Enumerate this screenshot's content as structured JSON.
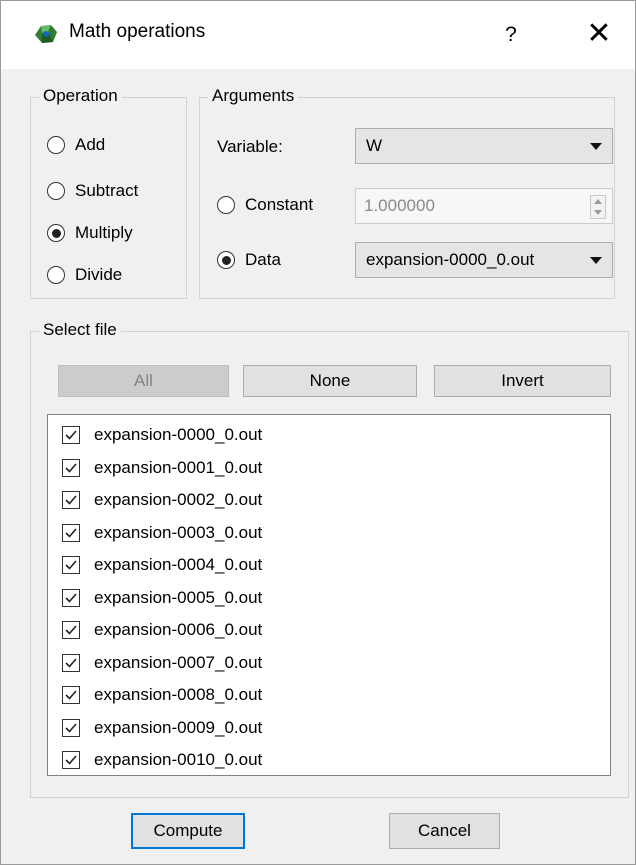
{
  "window": {
    "title": "Math operations",
    "help": "?",
    "close": "✕"
  },
  "operation": {
    "title": "Operation",
    "options": [
      {
        "label": "Add",
        "checked": false
      },
      {
        "label": "Subtract",
        "checked": false
      },
      {
        "label": "Multiply",
        "checked": true
      },
      {
        "label": "Divide",
        "checked": false
      }
    ]
  },
  "arguments": {
    "title": "Arguments",
    "variable_label": "Variable:",
    "variable_value": "W",
    "constant_label": "Constant",
    "constant_value": "1.000000",
    "constant_checked": false,
    "data_label": "Data",
    "data_value": "expansion-0000_0.out",
    "data_checked": true
  },
  "select_file": {
    "title": "Select file",
    "all_label": "All",
    "none_label": "None",
    "invert_label": "Invert",
    "files": [
      {
        "name": "expansion-0000_0.out",
        "checked": true
      },
      {
        "name": "expansion-0001_0.out",
        "checked": true
      },
      {
        "name": "expansion-0002_0.out",
        "checked": true
      },
      {
        "name": "expansion-0003_0.out",
        "checked": true
      },
      {
        "name": "expansion-0004_0.out",
        "checked": true
      },
      {
        "name": "expansion-0005_0.out",
        "checked": true
      },
      {
        "name": "expansion-0006_0.out",
        "checked": true
      },
      {
        "name": "expansion-0007_0.out",
        "checked": true
      },
      {
        "name": "expansion-0008_0.out",
        "checked": true
      },
      {
        "name": "expansion-0009_0.out",
        "checked": true
      },
      {
        "name": "expansion-0010_0.out",
        "checked": true
      }
    ]
  },
  "footer": {
    "compute_label": "Compute",
    "cancel_label": "Cancel"
  },
  "colors": {
    "accent": "#0078d7",
    "window_bg": "#f0f0f0"
  }
}
